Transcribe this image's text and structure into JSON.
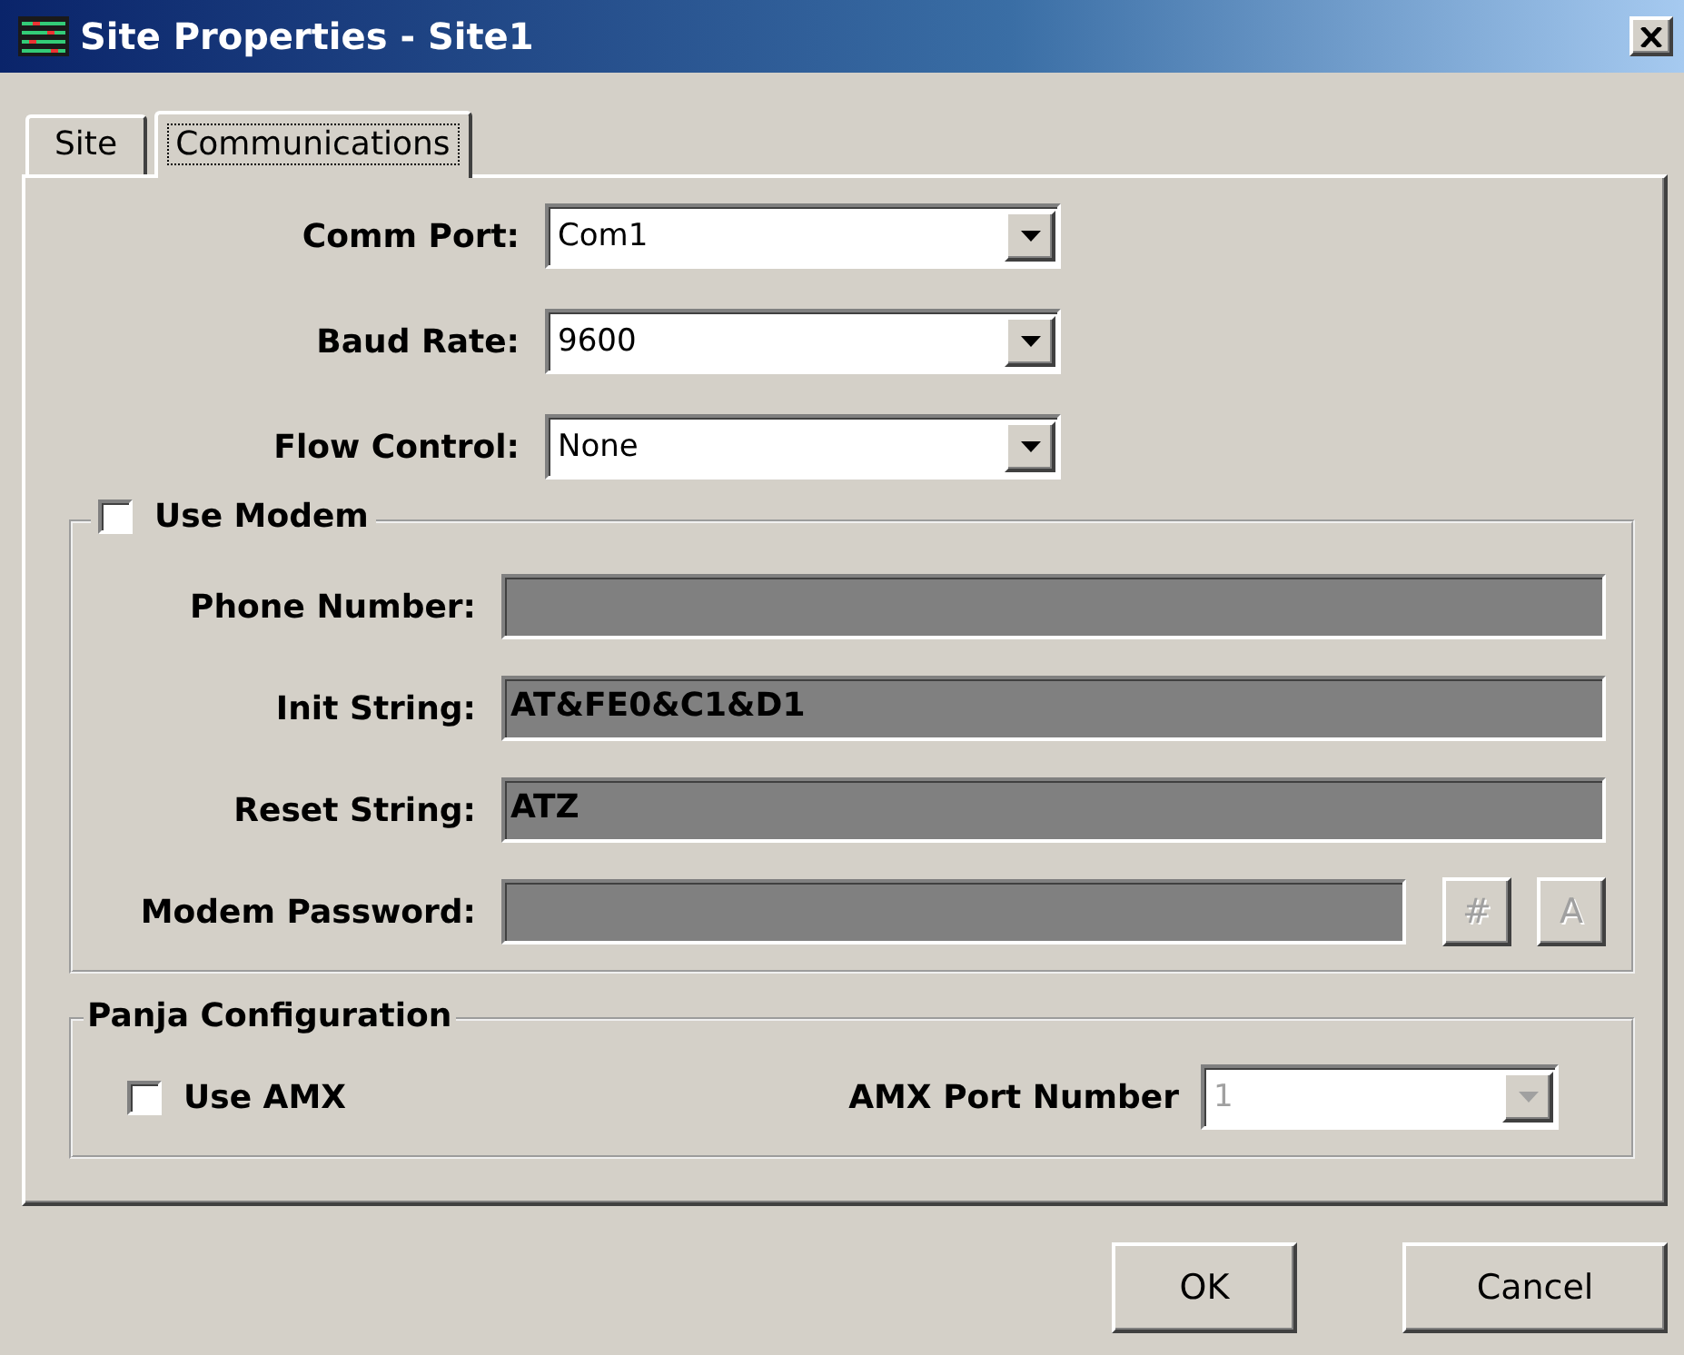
{
  "window": {
    "title": "Site Properties - Site1"
  },
  "tabs": [
    {
      "label": "Site",
      "selected": false
    },
    {
      "label": "Communications",
      "selected": true
    }
  ],
  "port_settings": [
    {
      "label": "Comm Port:",
      "value": "Com1"
    },
    {
      "label": "Baud Rate:",
      "value": "9600"
    },
    {
      "label": "Flow Control:",
      "value": "None"
    }
  ],
  "modem": {
    "label": "Use Modem",
    "checked": false,
    "fields": [
      {
        "label": "Phone Number:",
        "disabled": true
      },
      {
        "label": "Init String:",
        "value": "AT&FE0&C1&D1",
        "disabled": true
      },
      {
        "label": "Reset String:",
        "value": "ATZ",
        "disabled": true
      },
      {
        "label": "Modem Password:",
        "disabled": true,
        "buttons": [
          {
            "label": "#",
            "disabled": true
          },
          {
            "label": "A",
            "disabled": true
          }
        ]
      }
    ]
  },
  "panja": {
    "title": "Panja Configuration",
    "use_amx": {
      "label": "Use AMX",
      "checked": false
    },
    "port": {
      "label": "AMX Port Number",
      "value": "1",
      "disabled": true
    }
  },
  "buttons": [
    {
      "label": "OK"
    },
    {
      "label": "Cancel"
    }
  ]
}
